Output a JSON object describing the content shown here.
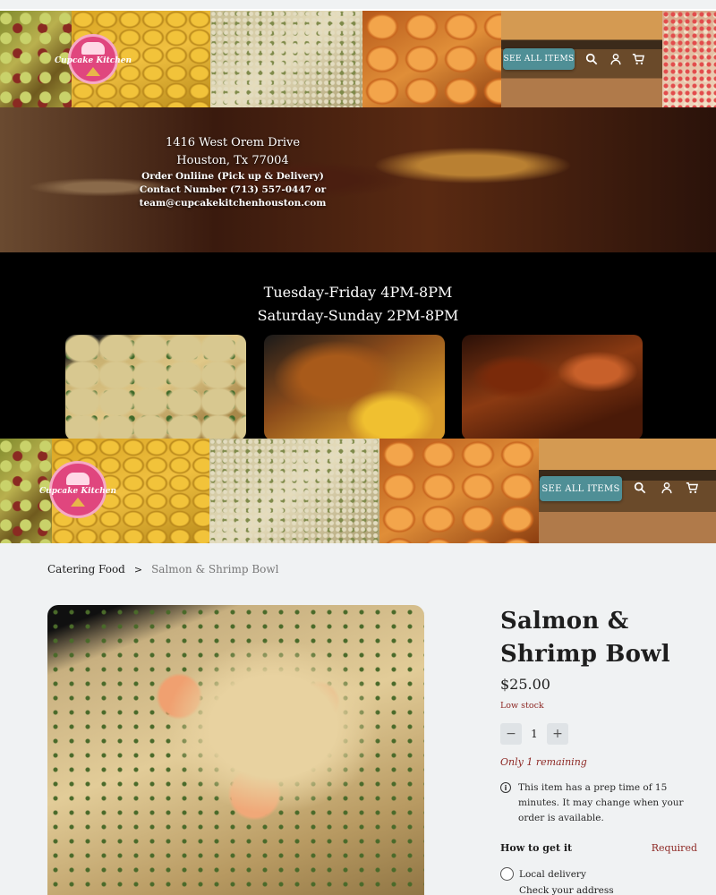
{
  "header": {
    "logo_text": "Cupcake Kitchen",
    "see_all_label": "SEE ALL ITEMS",
    "icons": [
      "search-icon",
      "user-icon",
      "cart-icon"
    ]
  },
  "hero": {
    "address_line1": "1416 West Orem Drive",
    "address_line2": "Houston, Tx 77004",
    "order_line": "Order Onliine (Pick up & Delivery)",
    "contact_line": "Contact Number (713) 557-0447 or",
    "email_line": "team@cupcakekitchenhouston.com"
  },
  "hours": {
    "weekday": "Tuesday-Friday 4PM-8PM",
    "weekend": "Saturday-Sunday 2PM-8PM"
  },
  "breadcrumb": {
    "parent": "Catering Food",
    "separator": ">",
    "current": "Salmon & Shrimp Bowl"
  },
  "product": {
    "title": "Salmon & Shrimp Bowl",
    "price": "$25.00",
    "stock_status": "Low stock",
    "quantity": "1",
    "minus": "−",
    "plus": "+",
    "remaining": "Only 1 remaining",
    "info_glyph": "i",
    "prep_note": "This item has a prep time of 15 minutes. It may change when your order is available.",
    "how_to_get": "How to get it",
    "required": "Required",
    "delivery_option": "Local delivery",
    "delivery_sub": "Check your address"
  },
  "colors": {
    "accent": "#4f8f96",
    "warning": "#8e2a26",
    "page_bg": "#f0f2f3",
    "logo_pink": "#e0467e"
  }
}
